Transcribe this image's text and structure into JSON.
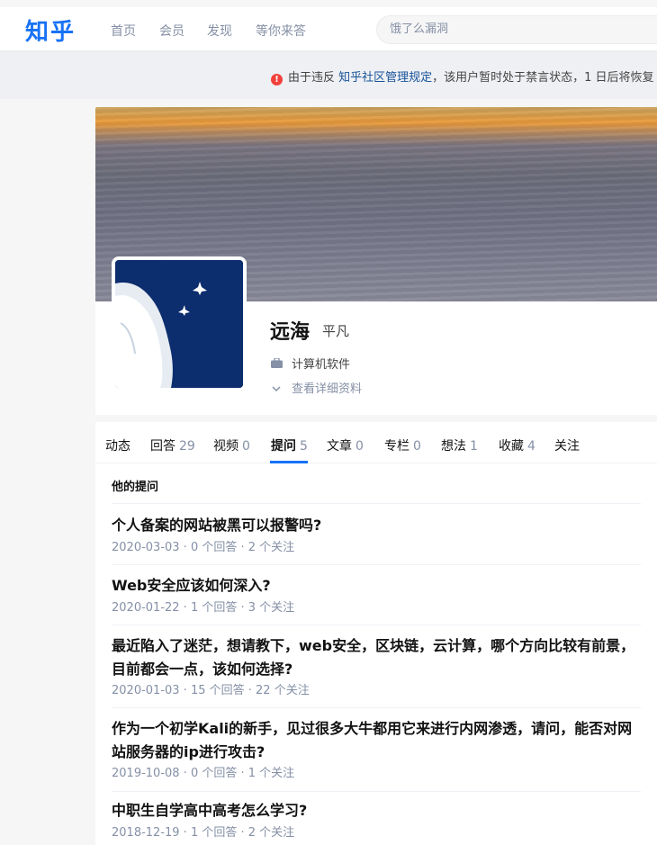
{
  "header": {
    "logo": "知乎",
    "nav": [
      "首页",
      "会员",
      "发现",
      "等你来答"
    ],
    "search_placeholder": "饿了么漏洞"
  },
  "notice": {
    "prefix": "由于违反 ",
    "link": "知乎社区管理规定",
    "suffix": "，该用户暂时处于禁言状态，1 日后将恢复"
  },
  "profile": {
    "name": "远海",
    "headline": "平凡",
    "industry": "计算机软件",
    "detail_link": "查看详细资料"
  },
  "tabs": [
    {
      "label": "动态",
      "count": ""
    },
    {
      "label": "回答",
      "count": "29"
    },
    {
      "label": "视频",
      "count": "0"
    },
    {
      "label": "提问",
      "count": "5"
    },
    {
      "label": "文章",
      "count": "0"
    },
    {
      "label": "专栏",
      "count": "0"
    },
    {
      "label": "想法",
      "count": "1"
    },
    {
      "label": "收藏",
      "count": "4"
    },
    {
      "label": "关注",
      "count": ""
    }
  ],
  "section_title": "他的提问",
  "questions": [
    {
      "title": "个人备案的网站被黑可以报警吗?",
      "meta": "2020-03-03 · 0 个回答 · 2 个关注"
    },
    {
      "title": "Web安全应该如何深入?",
      "meta": "2020-01-22 · 1 个回答 · 3 个关注"
    },
    {
      "title": "最近陷入了迷茫，想请教下，web安全，区块链，云计算，哪个方向比较有前景，目前都会一点，该如何选择?",
      "meta": "2020-01-03 · 15 个回答 · 22 个关注"
    },
    {
      "title": "作为一个初学Kali的新手，见过很多大牛都用它来进行内网渗透，请问，能否对网站服务器的ip进行攻击?",
      "meta": "2019-10-08 · 0 个回答 · 1 个关注"
    },
    {
      "title": "中职生自学高中高考怎么学习?",
      "meta": "2018-12-19 · 1 个回答 · 2 个关注"
    }
  ]
}
